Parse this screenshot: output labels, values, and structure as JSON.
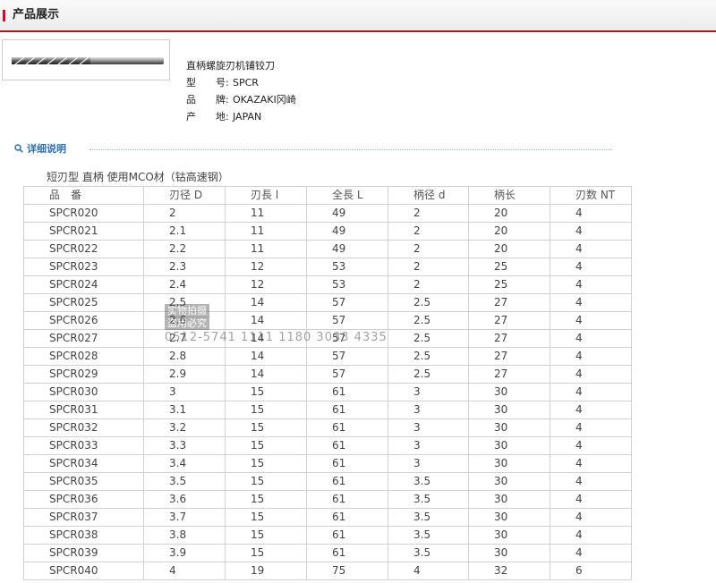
{
  "header": {
    "title": "产品展示"
  },
  "product": {
    "name": "直柄螺旋刃机铺铰刀",
    "details": [
      {
        "label": "型　　号:",
        "value": "SPCR"
      },
      {
        "label": "品　　牌:",
        "value": "OKAZAKI冈崎"
      },
      {
        "label": "产　　地:",
        "value": "JAPAN"
      }
    ]
  },
  "section": {
    "title": "详细说明"
  },
  "table": {
    "subtitle": "短刃型 直柄 使用MCO材（钴高速钢）",
    "headers": [
      "品　番",
      "刃径 D",
      "刃長 l",
      "全長 L",
      "柄径 d",
      "柄长",
      "刃数 NT"
    ],
    "rows": [
      [
        "SPCR020",
        "2",
        "11",
        "49",
        "2",
        "20",
        "4"
      ],
      [
        "SPCR021",
        "2.1",
        "11",
        "49",
        "2",
        "20",
        "4"
      ],
      [
        "SPCR022",
        "2.2",
        "11",
        "49",
        "2",
        "20",
        "4"
      ],
      [
        "SPCR023",
        "2.3",
        "12",
        "53",
        "2",
        "25",
        "4"
      ],
      [
        "SPCR024",
        "2.4",
        "12",
        "53",
        "2",
        "25",
        "4"
      ],
      [
        "SPCR025",
        "2.5",
        "14",
        "57",
        "2.5",
        "27",
        "4"
      ],
      [
        "SPCR026",
        "2.6",
        "14",
        "57",
        "2.5",
        "27",
        "4"
      ],
      [
        "SPCR027",
        "2.7",
        "14",
        "57",
        "2.5",
        "27",
        "4"
      ],
      [
        "SPCR028",
        "2.8",
        "14",
        "57",
        "2.5",
        "27",
        "4"
      ],
      [
        "SPCR029",
        "2.9",
        "14",
        "57",
        "2.5",
        "27",
        "4"
      ],
      [
        "SPCR030",
        "3",
        "15",
        "61",
        "3",
        "30",
        "4"
      ],
      [
        "SPCR031",
        "3.1",
        "15",
        "61",
        "3",
        "30",
        "4"
      ],
      [
        "SPCR032",
        "3.2",
        "15",
        "61",
        "3",
        "30",
        "4"
      ],
      [
        "SPCR033",
        "3.3",
        "15",
        "61",
        "3",
        "30",
        "4"
      ],
      [
        "SPCR034",
        "3.4",
        "15",
        "61",
        "3",
        "30",
        "4"
      ],
      [
        "SPCR035",
        "3.5",
        "15",
        "61",
        "3.5",
        "30",
        "4"
      ],
      [
        "SPCR036",
        "3.6",
        "15",
        "61",
        "3.5",
        "30",
        "4"
      ],
      [
        "SPCR037",
        "3.7",
        "15",
        "61",
        "3.5",
        "30",
        "4"
      ],
      [
        "SPCR038",
        "3.8",
        "15",
        "61",
        "3.5",
        "30",
        "4"
      ],
      [
        "SPCR039",
        "3.9",
        "15",
        "61",
        "3.5",
        "30",
        "4"
      ],
      [
        "SPCR040",
        "4",
        "19",
        "75",
        "4",
        "32",
        "6"
      ]
    ]
  },
  "watermark": {
    "line1": "实物拍摄",
    "line2": "盗用必究",
    "phone": "0512-5741 1111 1180 3033 4335"
  },
  "colors": {
    "accent": "#b5121b",
    "link": "#2c6fb3"
  }
}
